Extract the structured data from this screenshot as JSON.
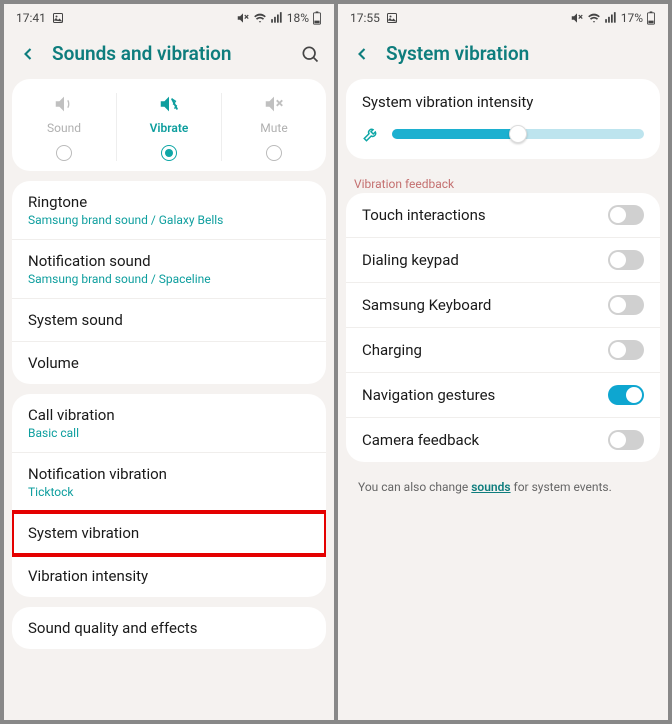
{
  "left": {
    "status": {
      "time": "17:41",
      "battery": "18%"
    },
    "header": {
      "title": "Sounds and vibration"
    },
    "mode": {
      "sound": "Sound",
      "vibrate": "Vibrate",
      "mute": "Mute"
    },
    "items1": [
      {
        "title": "Ringtone",
        "sub": "Samsung brand sound / Galaxy Bells"
      },
      {
        "title": "Notification sound",
        "sub": "Samsung brand sound / Spaceline"
      },
      {
        "title": "System sound",
        "sub": ""
      },
      {
        "title": "Volume",
        "sub": ""
      }
    ],
    "items2": [
      {
        "title": "Call vibration",
        "sub": "Basic call"
      },
      {
        "title": "Notification vibration",
        "sub": "Ticktock"
      },
      {
        "title": "System vibration",
        "sub": "",
        "highlight": true
      },
      {
        "title": "Vibration intensity",
        "sub": ""
      }
    ],
    "items3": [
      {
        "title": "Sound quality and effects",
        "sub": ""
      }
    ]
  },
  "right": {
    "status": {
      "time": "17:55",
      "battery": "17%"
    },
    "header": {
      "title": "System vibration"
    },
    "intensity_label": "System vibration intensity",
    "slider_value": 50,
    "section_label": "Vibration feedback",
    "toggles": [
      {
        "label": "Touch interactions",
        "on": false
      },
      {
        "label": "Dialing keypad",
        "on": false
      },
      {
        "label": "Samsung Keyboard",
        "on": false
      },
      {
        "label": "Charging",
        "on": false
      },
      {
        "label": "Navigation gestures",
        "on": true
      },
      {
        "label": "Camera feedback",
        "on": false
      }
    ],
    "footer_pre": "You can also change ",
    "footer_link": "sounds",
    "footer_post": " for system events."
  }
}
